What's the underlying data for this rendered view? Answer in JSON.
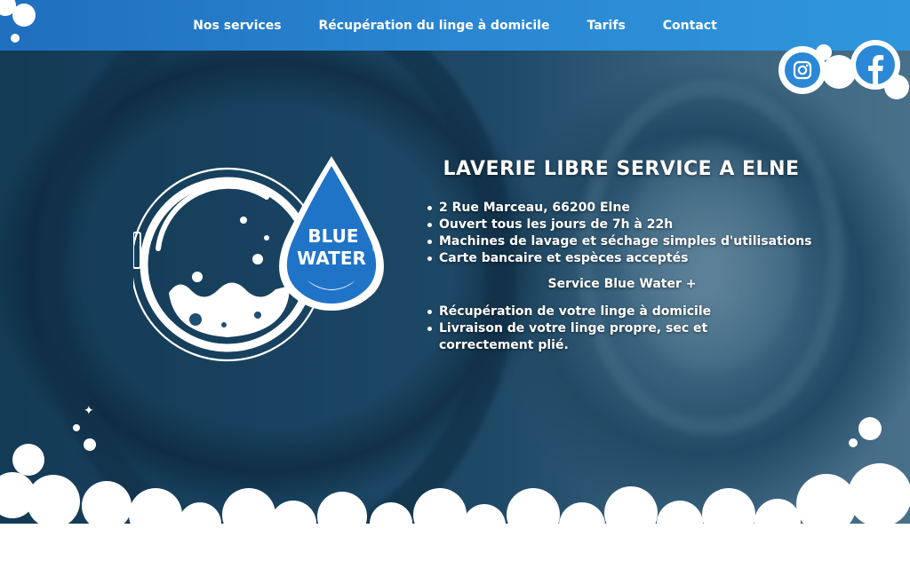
{
  "nav": {
    "items": [
      "Nos services",
      "Récupération du linge à domicile",
      "Tarifs",
      "Contact"
    ]
  },
  "social": {
    "icons": [
      "instagram-icon",
      "facebook-icon"
    ]
  },
  "logo": {
    "line1": "BLUE",
    "line2": "WATER",
    "mark": "®"
  },
  "content": {
    "title": "LAVERIE LIBRE SERVICE A ELNE",
    "features": [
      "2 Rue Marceau, 66200 Elne",
      "Ouvert tous les jours de 7h à 22h",
      "Machines de lavage et séchage simples d'utilisations",
      "Carte bancaire et espèces acceptés"
    ],
    "plus_title": "Service Blue Water +",
    "plus_features": [
      "Récupération de votre linge à domicile",
      "Livraison de votre linge propre, sec et correctement plié."
    ]
  },
  "colors": {
    "header": "#2a86d2",
    "brand_blue": "#1f74c8",
    "foam": "#ffffff"
  }
}
